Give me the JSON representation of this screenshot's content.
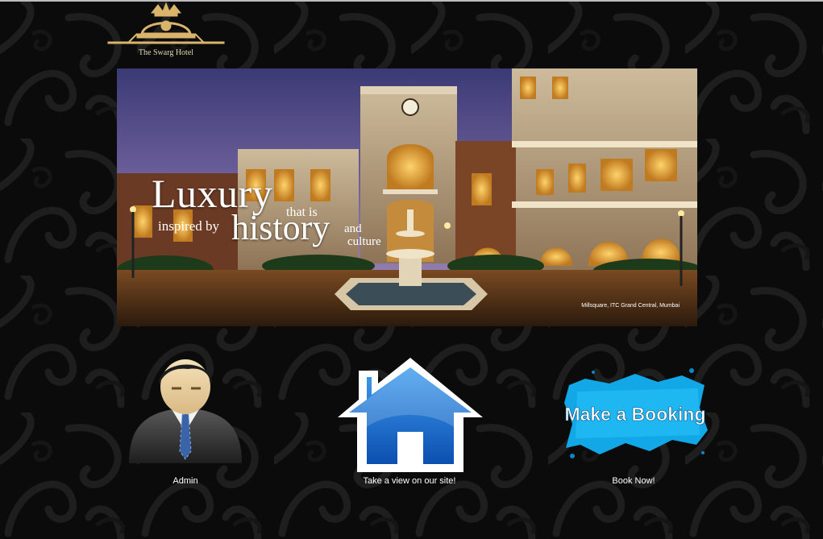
{
  "site": {
    "logo_text": "The Swarg Hotel"
  },
  "banner": {
    "headline_word1": "Luxury",
    "headline_that_is": "that is",
    "headline_inspired_by": "inspired by",
    "headline_word2": "history",
    "headline_and": "and",
    "headline_culture": "culture",
    "caption": "Millsquare, ITC Grand Central, Mumbai"
  },
  "actions": [
    {
      "label": "Admin",
      "icon": "admin-user-icon"
    },
    {
      "label": "Take a view on our site!",
      "icon": "home-icon"
    },
    {
      "label": "Book Now!",
      "button_text": "Make a Booking",
      "icon": "booking-badge"
    }
  ],
  "colors": {
    "background": "#0b0b0b",
    "pattern": "#1c1c1c",
    "home_blue": "#1a73d9",
    "booking_cyan": "#12a7e6"
  }
}
